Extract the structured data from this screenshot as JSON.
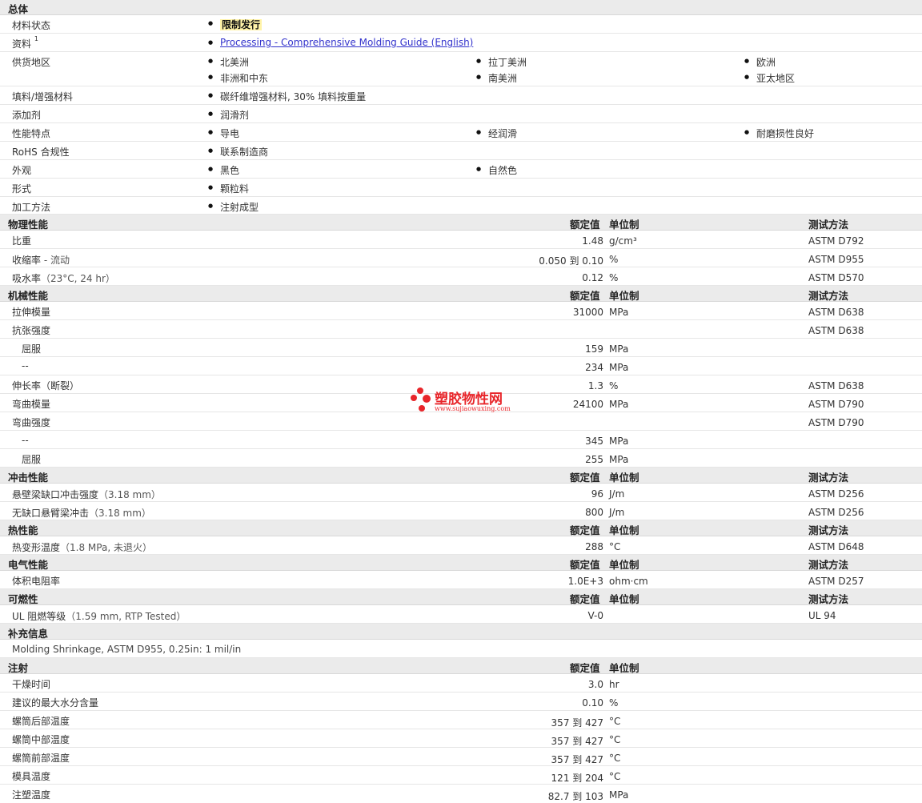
{
  "general": {
    "title": "总体",
    "material_status_label": "材料状态",
    "material_status_value": "限制发行",
    "docs_label": "资料",
    "docs_footnote": "1",
    "docs_link": "Processing - Comprehensive Molding Guide (English)",
    "supply_label": "供货地区",
    "supply_regions": [
      "北美洲",
      "拉丁美洲",
      "欧洲",
      "非洲和中东",
      "南美洲",
      "亚太地区"
    ],
    "filler_label": "填料/增强材料",
    "filler_value": "碳纤维增强材料, 30% 填料按重量",
    "additive_label": "添加剂",
    "additive_value": "润滑剂",
    "features_label": "性能特点",
    "features": [
      "导电",
      "经润滑",
      "耐磨损性良好"
    ],
    "rohs_label": "RoHS 合规性",
    "rohs_value": "联系制造商",
    "appearance_label": "外观",
    "appearance": [
      "黑色",
      "自然色"
    ],
    "form_label": "形式",
    "form_value": "颗粒料",
    "process_label": "加工方法",
    "process_value": "注射成型"
  },
  "headers": {
    "value": "额定值",
    "unit": "单位制",
    "method": "测试方法"
  },
  "physical": {
    "title": "物理性能",
    "rows": [
      {
        "label": "比重",
        "cond": "",
        "value": "1.48",
        "unit": "g/cm³",
        "method": "ASTM D792"
      },
      {
        "label": "收缩率",
        "cond": " - 流动",
        "value": "0.050 到  0.10",
        "unit": "%",
        "method": "ASTM D955"
      },
      {
        "label": "吸水率",
        "cond": "（23°C, 24 hr）",
        "value": "0.12",
        "unit": "%",
        "method": "ASTM D570"
      }
    ]
  },
  "mechanical": {
    "title": "机械性能",
    "rows": [
      {
        "label": "拉伸模量",
        "value": "31000",
        "unit": "MPa",
        "method": "ASTM D638"
      },
      {
        "label": "抗张强度",
        "value": "",
        "unit": "",
        "method": "ASTM D638"
      },
      {
        "label": "屈服",
        "value": "159",
        "unit": "MPa",
        "method": ""
      },
      {
        "label": "--",
        "value": "234",
        "unit": "MPa",
        "method": ""
      },
      {
        "label": "伸长率（断裂）",
        "value": "1.3",
        "unit": "%",
        "method": "ASTM D638"
      },
      {
        "label": "弯曲模量",
        "value": "24100",
        "unit": "MPa",
        "method": "ASTM D790"
      },
      {
        "label": "弯曲强度",
        "value": "",
        "unit": "",
        "method": "ASTM D790"
      },
      {
        "label": "--",
        "value": "345",
        "unit": "MPa",
        "method": ""
      },
      {
        "label": "屈服",
        "value": "255",
        "unit": "MPa",
        "method": ""
      }
    ]
  },
  "impact": {
    "title": "冲击性能",
    "rows": [
      {
        "label": "悬壁梁缺口冲击强度",
        "cond": "（3.18 mm）",
        "value": "96",
        "unit": "J/m",
        "method": "ASTM D256"
      },
      {
        "label": "无缺口悬臂梁冲击",
        "cond": "（3.18 mm）",
        "value": "800",
        "unit": "J/m",
        "method": "ASTM D256"
      }
    ]
  },
  "thermal": {
    "title": "热性能",
    "rows": [
      {
        "label": "热变形温度",
        "cond": "（1.8 MPa, 未退火）",
        "value": "288",
        "unit": "°C",
        "method": "ASTM D648"
      }
    ]
  },
  "electrical": {
    "title": "电气性能",
    "rows": [
      {
        "label": "体积电阻率",
        "cond": "",
        "value": "1.0E+3",
        "unit": "ohm·cm",
        "method": "ASTM D257"
      }
    ]
  },
  "flammability": {
    "title": "可燃性",
    "rows": [
      {
        "label": "UL 阻燃等级",
        "cond": "（1.59 mm, RTP Tested）",
        "value": "V-0",
        "unit": "",
        "method": "UL 94"
      }
    ]
  },
  "supplement": {
    "title": "补充信息",
    "note": "Molding Shrinkage, ASTM D955, 0.25in: 1 mil/in"
  },
  "injection": {
    "title": "注射",
    "rows": [
      {
        "label": "干燥时间",
        "value": "3.0",
        "unit": "hr"
      },
      {
        "label": "建议的最大水分含量",
        "value": "0.10",
        "unit": "%"
      },
      {
        "label": "螺筒后部温度",
        "value": "357 到  427",
        "unit": "°C"
      },
      {
        "label": "螺筒中部温度",
        "value": "357 到  427",
        "unit": "°C"
      },
      {
        "label": "螺筒前部温度",
        "value": "357 到  427",
        "unit": "°C"
      },
      {
        "label": "模具温度",
        "value": "121 到  204",
        "unit": "°C"
      },
      {
        "label": "注塑温度",
        "value": "82.7 到  103",
        "unit": "MPa"
      }
    ]
  },
  "watermark": {
    "name": "塑胶物性网",
    "url": "www.sujiaowuxing.com"
  },
  "colors": {
    "section_bg": "#ebebeb",
    "link": "#3333cc",
    "highlight": "#fff3a8",
    "watermark": "#e8252a"
  }
}
